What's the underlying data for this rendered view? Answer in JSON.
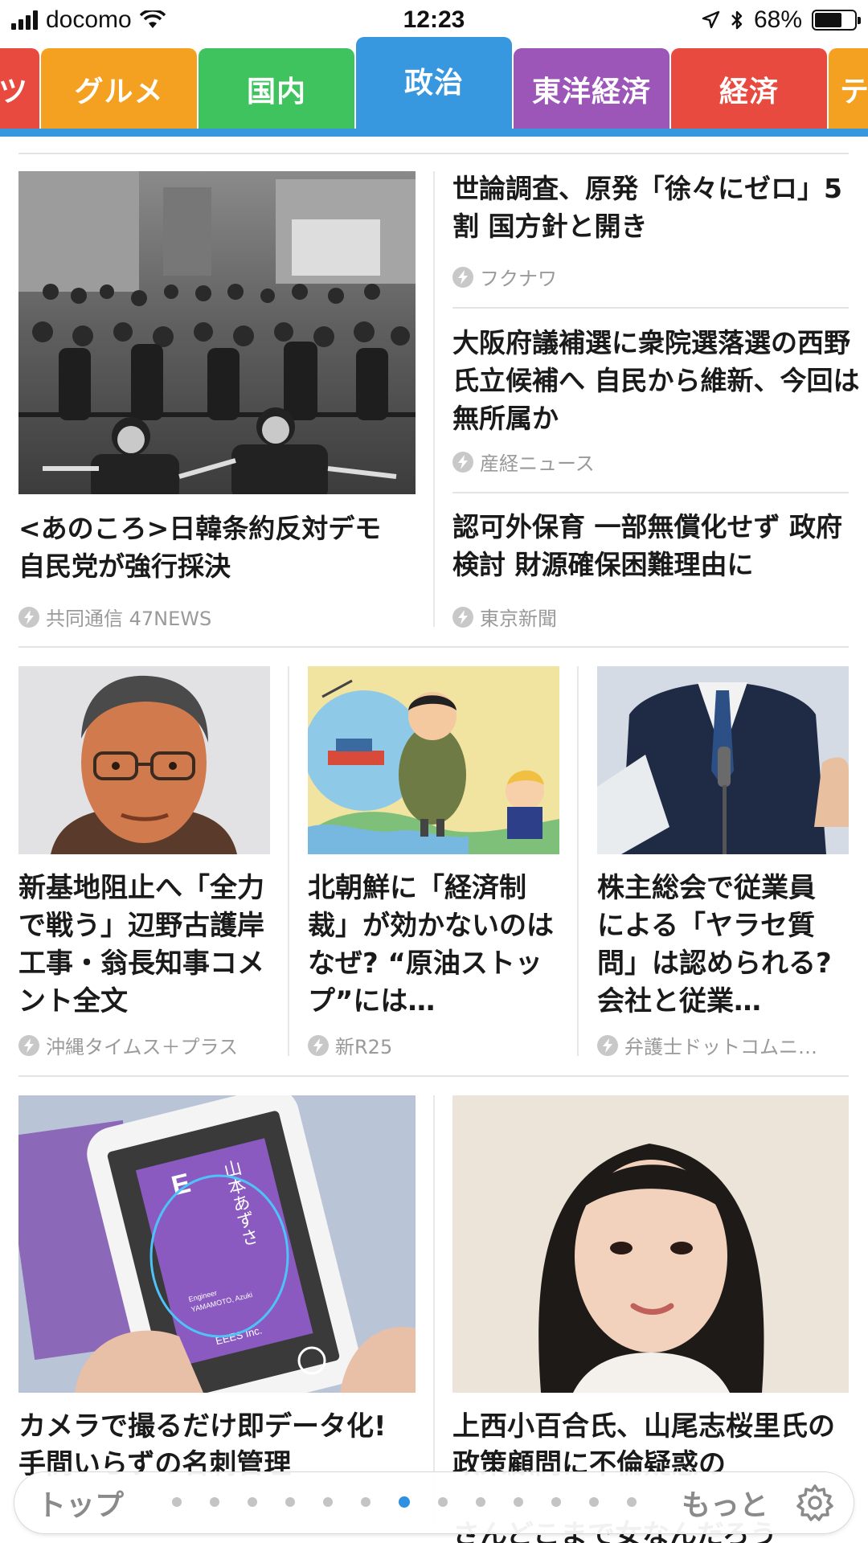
{
  "status_bar": {
    "carrier": "docomo",
    "time": "12:23",
    "battery_percent": "68%",
    "battery_level": 0.68
  },
  "tabs": [
    {
      "label": "ツ",
      "color": "#e84a3f"
    },
    {
      "label": "グルメ",
      "color": "#f4a020"
    },
    {
      "label": "国内",
      "color": "#3ec35e"
    },
    {
      "label": "政治",
      "color": "#3797df",
      "active": true
    },
    {
      "label": "東洋経済",
      "color": "#9b56b8"
    },
    {
      "label": "経済",
      "color": "#e84a3f"
    },
    {
      "label": "テ",
      "color": "#f4a020"
    }
  ],
  "articles": {
    "featured": {
      "title": "<あのころ>日韓条約反対デモ 自民党が強行採決",
      "source": "共同通信 47NEWS"
    },
    "side": [
      {
        "title": "世論調査、原発「徐々にゼロ」5割 国方針と開き",
        "source": "フクナワ"
      },
      {
        "title": "大阪府議補選に衆院選落選の西野氏立候補へ 自民から維新、今回は無所属か",
        "source": "産経ニュース"
      },
      {
        "title": "認可外保育 一部無償化せず 政府検討 財源確保困難理由に",
        "source": "東京新聞"
      }
    ],
    "row3": [
      {
        "title": "新基地阻止へ「全力で戦う」辺野古護岸工事・翁長知事コメント全文",
        "source": "沖縄タイムス＋プラス"
      },
      {
        "title": "北朝鮮に「経済制裁」が効かないのはなぜ? “原油ストップ”には…",
        "source": "新R25"
      },
      {
        "title": "株主総会で従業員による「ヤラセ質問」は認められる? 会社と従業…",
        "source": "弁護士ドットコムニ…"
      }
    ],
    "row4": [
      {
        "title": "カメラで撮るだけ即データ化! 手間いらずの名刺管理"
      },
      {
        "title": "上西小百合氏、山尾志桜里氏の政策顧問に不倫疑惑の"
      }
    ],
    "peek_text": "さんどこまで女なんだろう"
  },
  "card_image_text": {
    "name_vertical": "山本あずさ",
    "name_roman": "YAMAMOTO, Azuki",
    "company": "EEES Inc.",
    "role": "Engineer",
    "logo": "E"
  },
  "bottom_nav": {
    "top_label": "トップ",
    "more_label": "もっと",
    "page_count": 13,
    "active_page": 7
  }
}
